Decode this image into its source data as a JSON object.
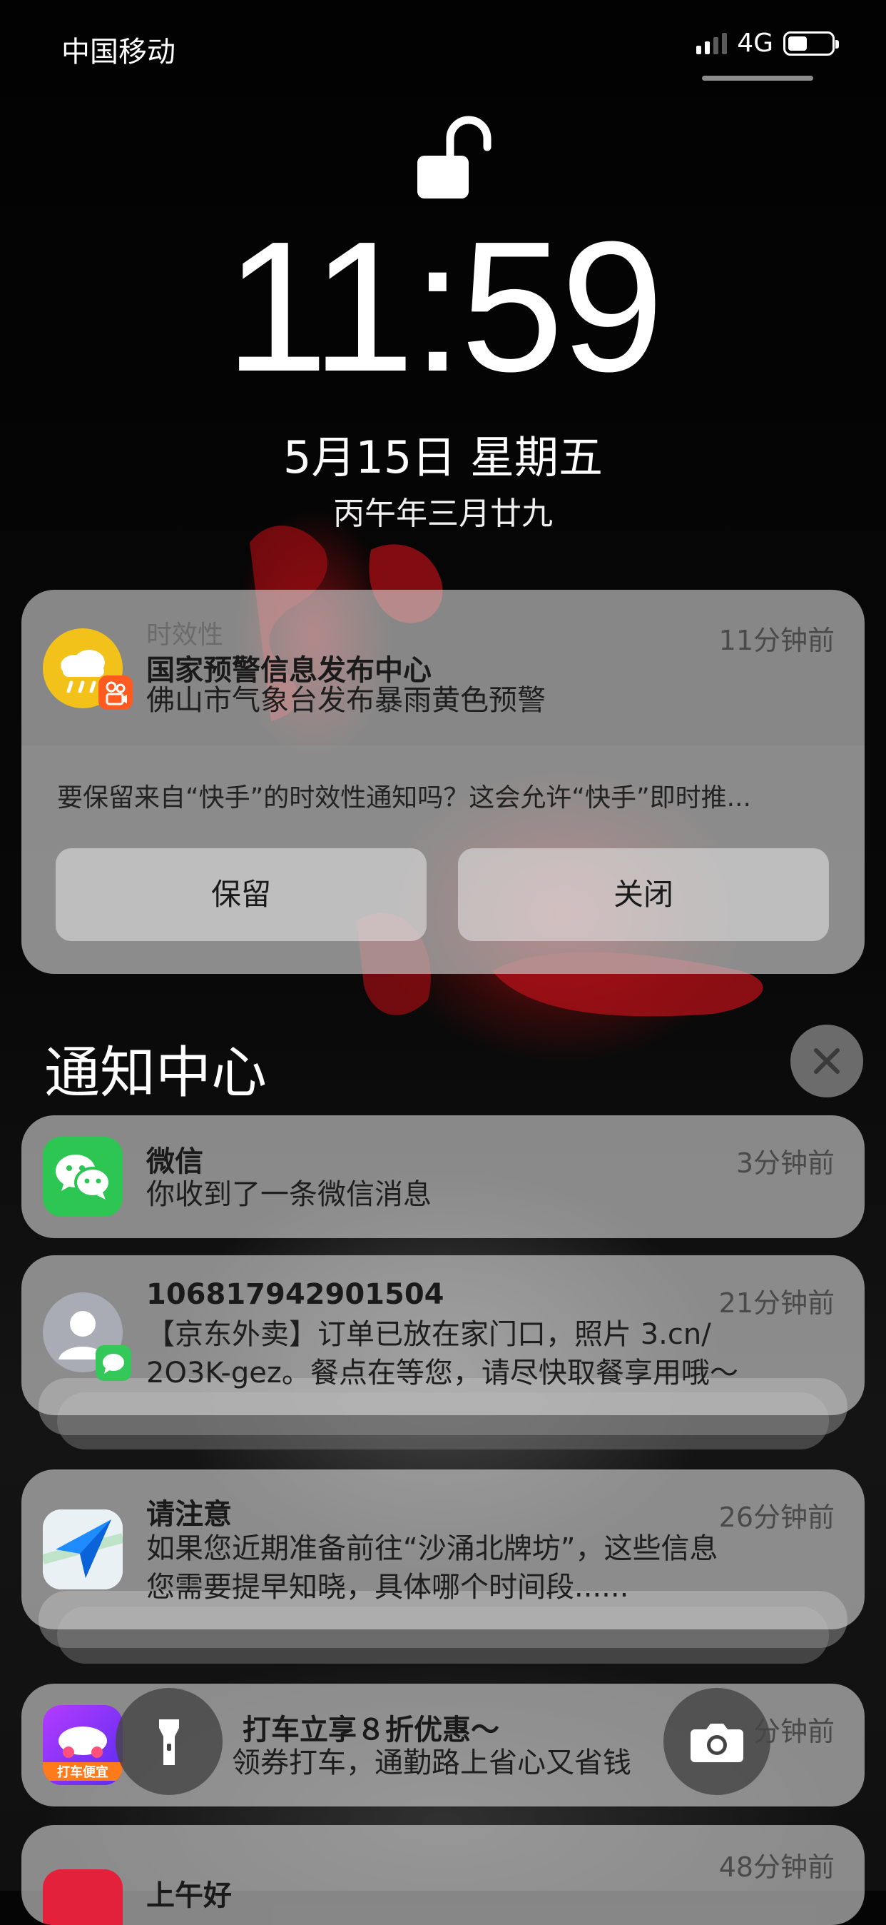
{
  "status_bar": {
    "carrier": "中国移动",
    "network": "4G"
  },
  "lock_screen": {
    "time": "11:59",
    "date": "5月15日 星期五",
    "lunar_date": "丙午年三月廿九"
  },
  "time_sensitive": {
    "category": "时效性",
    "time": "11分钟前",
    "title": "国家预警信息发布中心",
    "body": "佛山市气象台发布暴雨黄色预警",
    "prompt": "要保留来自“快手”的时效性通知吗？这会允许“快手”即时推...",
    "keep_label": "保留",
    "close_label": "关闭"
  },
  "notification_center": {
    "title": "通知中心"
  },
  "notifications": [
    {
      "app": "微信",
      "time": "3分钟前",
      "body": [
        "你收到了一条微信消息"
      ]
    },
    {
      "app": "106817942901504",
      "time": "21分钟前",
      "body": [
        "【京东外卖】订单已放在家门口，照片 3.cn/",
        "2O3K-gez。餐点在等您，请尽快取餐享用哦～"
      ]
    },
    {
      "app": "请注意",
      "time": "26分钟前",
      "body": [
        "如果您近期准备前往“沙涌北牌坊”，这些信息",
        "您需要提早知晓，具体哪个时间段......"
      ]
    },
    {
      "app": "打车立享８折优惠～",
      "time": "分钟前",
      "body": [
        "领券打车，通勤路上省心又省钱"
      ],
      "icon_text": "打车便宜"
    },
    {
      "app": "上午好",
      "time": "48分钟前",
      "body": []
    }
  ],
  "icons": {
    "weather": "weather-rain-icon",
    "kuaishou": "kuaishou-icon",
    "wechat": "wechat-icon",
    "contact": "contact-icon",
    "messages": "messages-icon",
    "maps": "maps-icon",
    "flashlight": "flashlight-icon",
    "camera": "camera-icon",
    "lock": "unlocked-icon",
    "close": "close-icon"
  },
  "colors": {
    "weather_icon": "#f2c21a",
    "kuaishou_badge": "#ff5a1f",
    "wechat": "#2dc653",
    "messages": "#34c759",
    "ride_app": "#7b2cf5"
  }
}
